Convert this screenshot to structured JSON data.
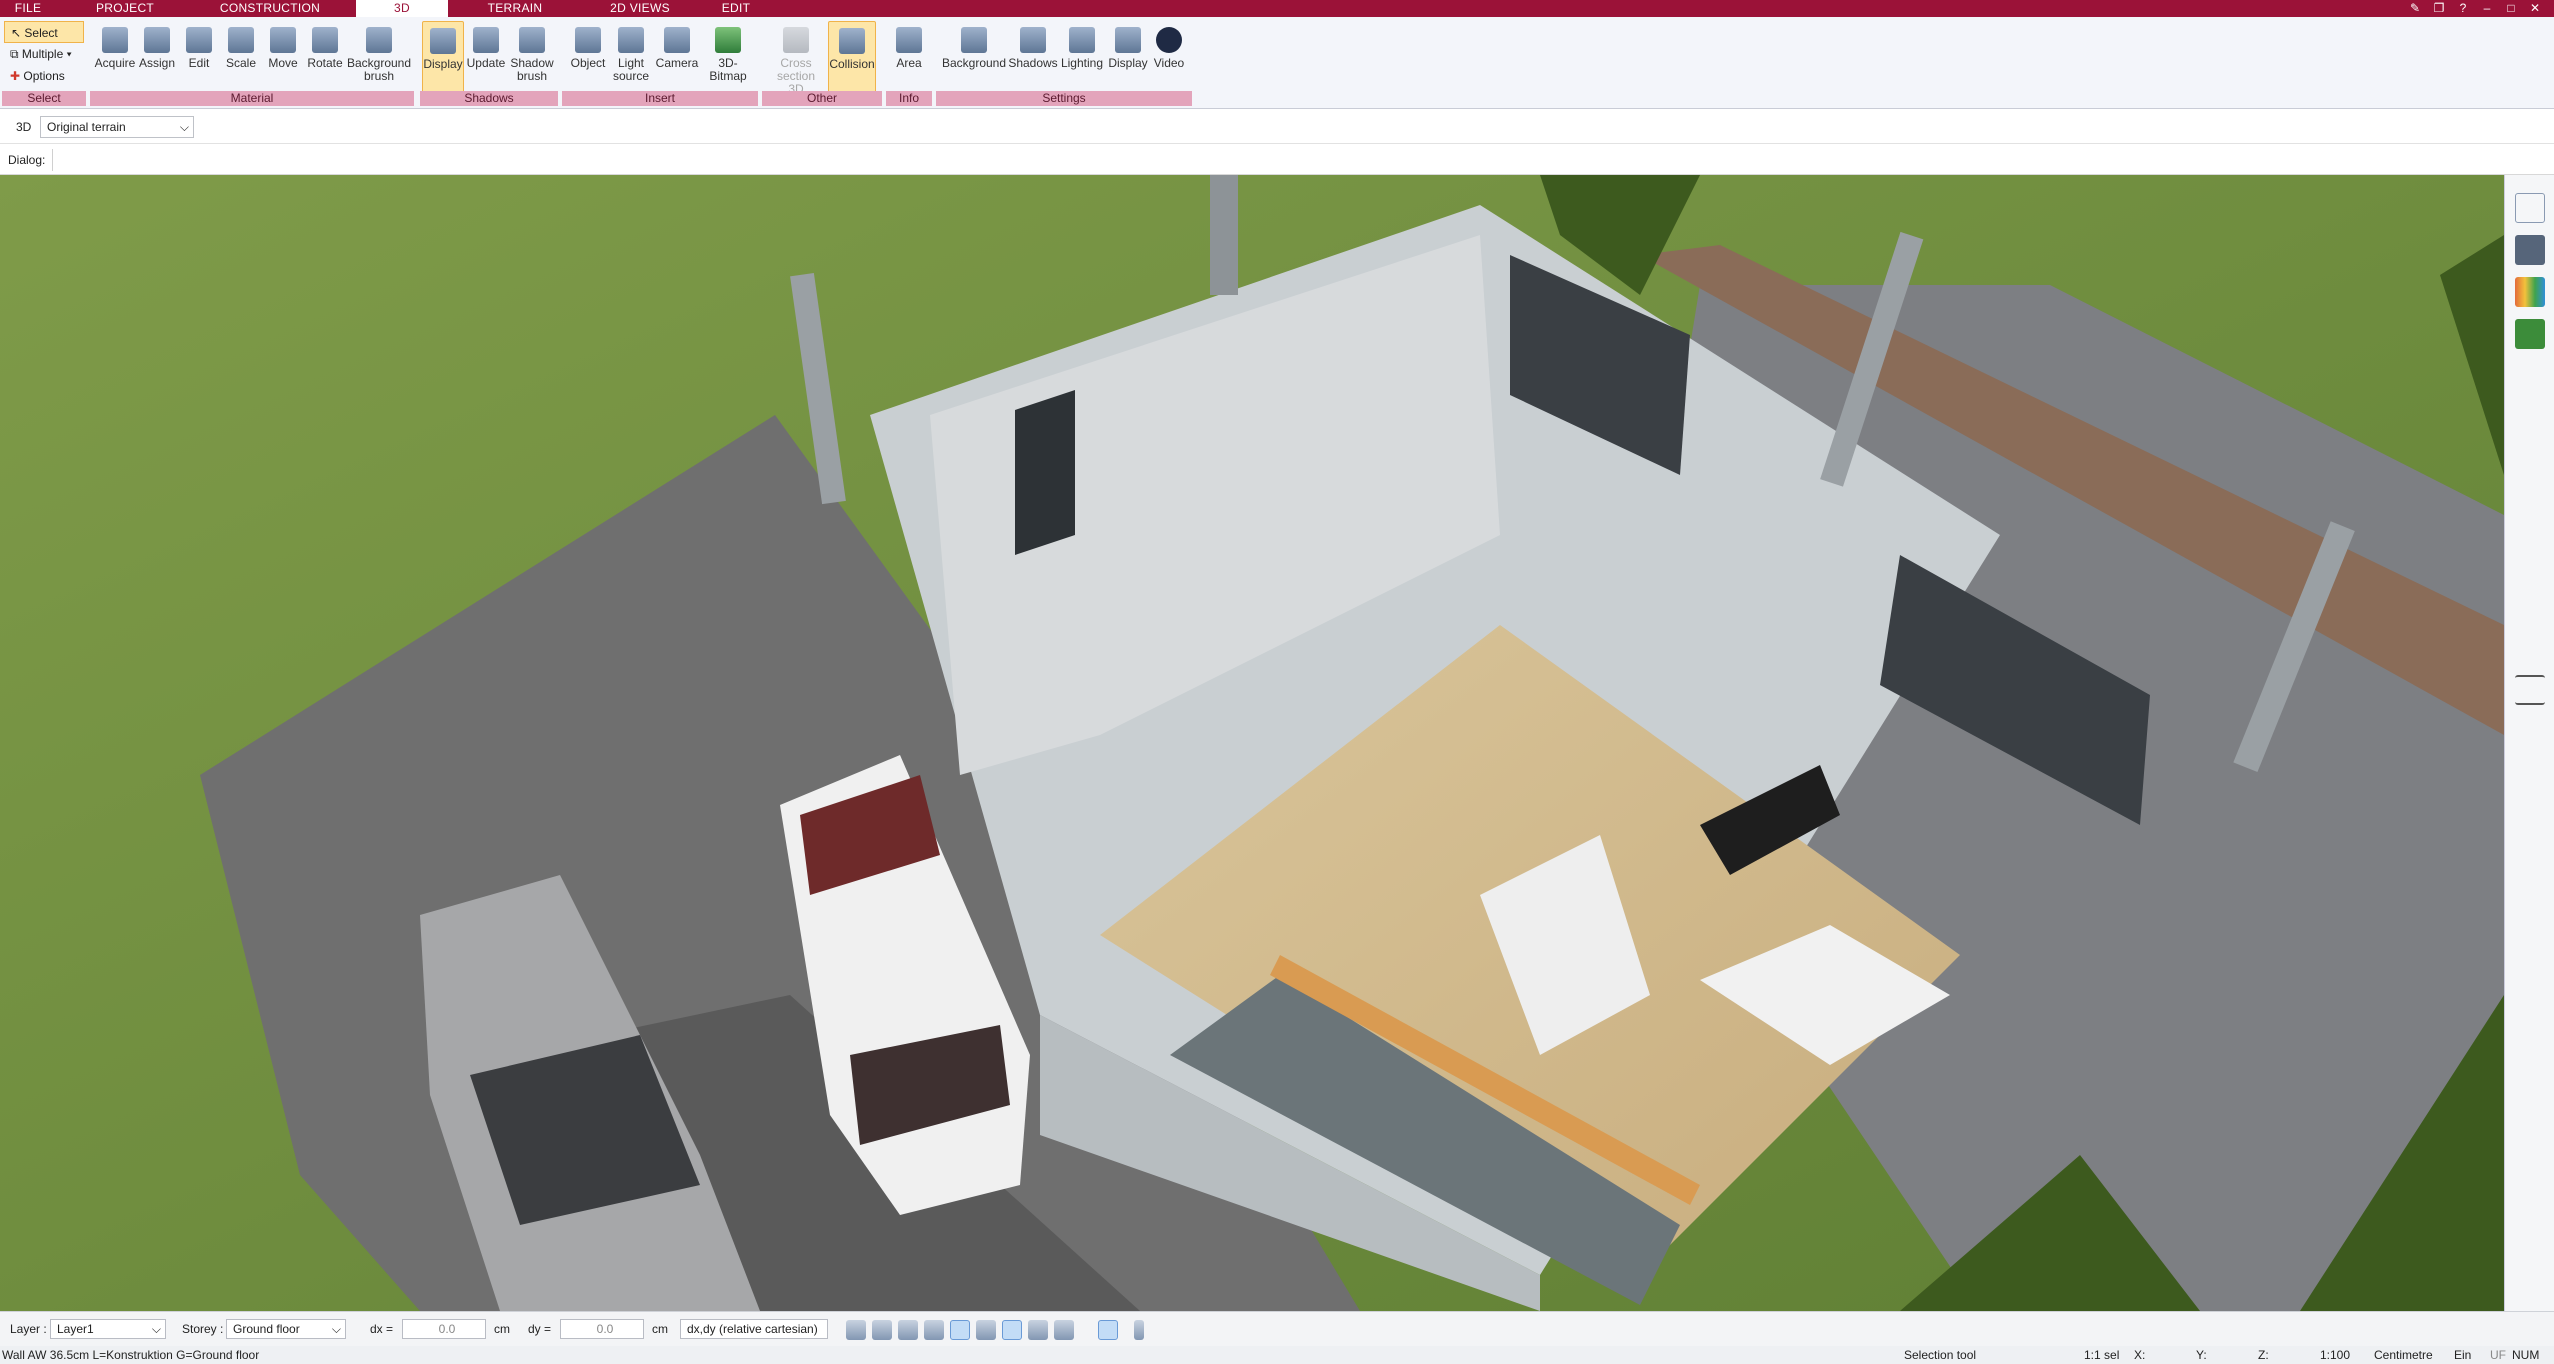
{
  "menu": {
    "tabs": [
      "FILE",
      "PROJECT",
      "CONSTRUCTION",
      "3D",
      "TERRAIN",
      "2D VIEWS",
      "EDIT"
    ],
    "active": "3D"
  },
  "ribbon": {
    "select": {
      "items": [
        "Select",
        "Multiple",
        "Options"
      ],
      "group": "Select"
    },
    "material": {
      "buttons": [
        "Acquire",
        "Assign",
        "Edit",
        "Scale",
        "Move",
        "Rotate",
        "Background brush"
      ],
      "group": "Material"
    },
    "shadows": {
      "buttons": [
        "Display",
        "Update",
        "Shadow brush"
      ],
      "group": "Shadows"
    },
    "insert": {
      "buttons": [
        "Object",
        "Light source",
        "Camera",
        "3D-Bitmap"
      ],
      "group": "Insert"
    },
    "other": {
      "buttons": [
        "Cross section 3D",
        "Collision"
      ],
      "group": "Other"
    },
    "info": {
      "buttons": [
        "Area"
      ],
      "group": "Info"
    },
    "settings": {
      "buttons": [
        "Background",
        "Shadows",
        "Lighting",
        "Display",
        "Video"
      ],
      "group": "Settings"
    }
  },
  "view_bar": {
    "mode": "3D",
    "terrain_select": "Original terrain"
  },
  "dialog_bar": {
    "label": "Dialog:"
  },
  "status": {
    "layer_label": "Layer :",
    "layer_value": "Layer1",
    "storey_label": "Storey :",
    "storey_value": "Ground floor",
    "dx_label": "dx =",
    "dx_value": "0.0",
    "dy_label": "dy =",
    "dy_value": "0.0",
    "unit": "cm",
    "coord_mode": "dx,dy (relative cartesian)"
  },
  "statusbar": {
    "info": "Wall AW 36.5cm L=Konstruktion G=Ground floor",
    "tool": "Selection tool",
    "scale_sel": "1:1 sel",
    "x_label": "X:",
    "y_label": "Y:",
    "z_label": "Z:",
    "scale": "1:100",
    "units": "Centimetre",
    "ein": "Ein",
    "uf": "UF",
    "num": "NUM"
  },
  "colors": {
    "brand": "#9b1238",
    "group_bar": "#e3a4bb",
    "active": "#fde6a8"
  }
}
